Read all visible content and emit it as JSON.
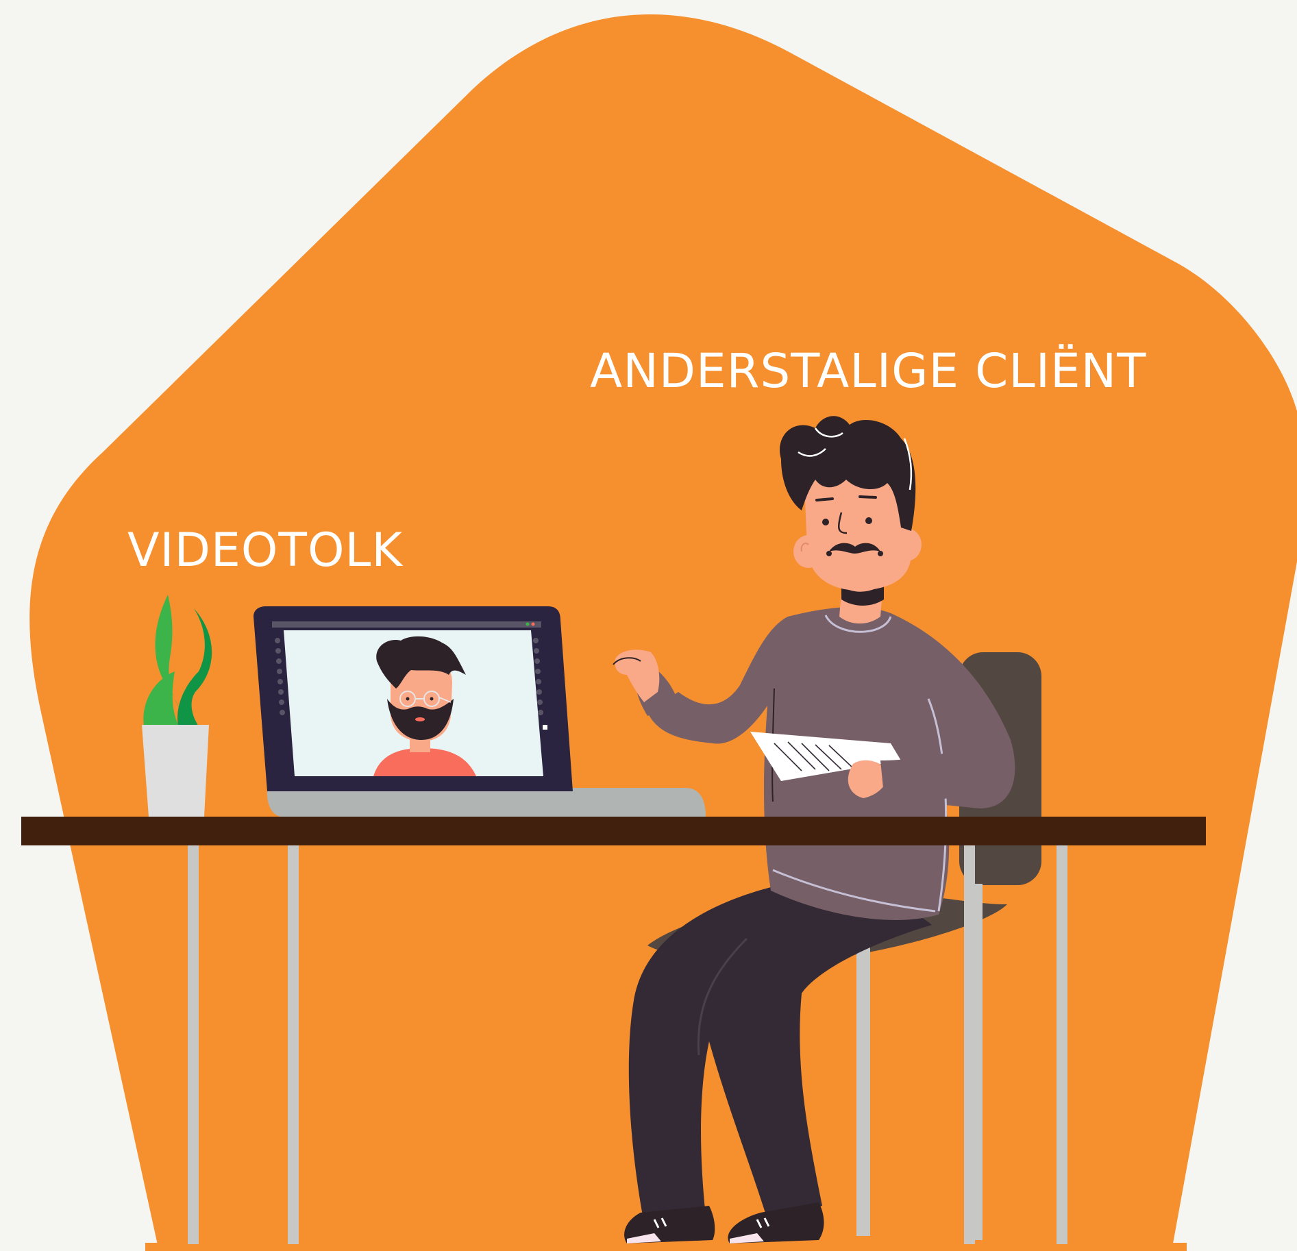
{
  "labels": {
    "videotolk": "VIDEOTOLK",
    "client": "ANDERSTALIGE CLIËNT"
  },
  "colors": {
    "background": "#f5f5f1",
    "blob": "#f6902e",
    "desk_top": "#41210d",
    "desk_leg": "#c7c7c5",
    "laptop_frame": "#2b2440",
    "laptop_screen": "#e9f4f4",
    "laptop_base": "#b0b4b3",
    "plant_light": "#3cb44a",
    "plant_dark": "#0f9545",
    "pot": "#dfdfdf",
    "chair": "#524741",
    "sweater": "#765f66",
    "trousers": "#342a36",
    "skin": "#f9a888",
    "hair": "#2c2228",
    "shirt_on_screen": "#f86d5b",
    "paper": "#ffffff"
  },
  "icons": {
    "plant": "potted-plant-icon",
    "laptop": "laptop-icon",
    "interpreter": "video-interpreter-avatar",
    "client": "client-person-illustration"
  }
}
